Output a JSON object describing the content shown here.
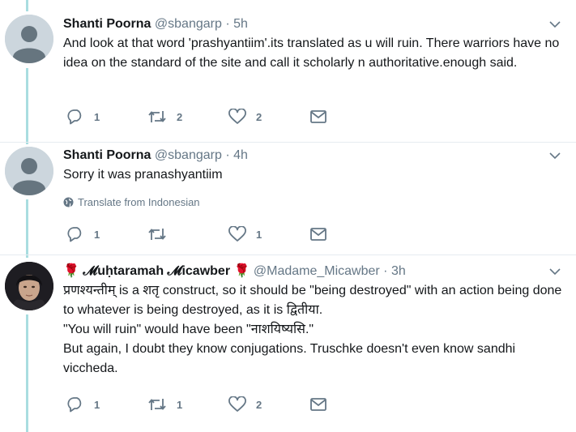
{
  "tweets": [
    {
      "name": "Shanti Poorna",
      "handle": "@sbangarp",
      "dot": " · ",
      "time": "5h",
      "text": "And look at that word 'prashyantiim'.its translated as u will ruin. There warriors have no idea on the standard of the site  and call it scholarly n authoritative.enough said.",
      "actions": {
        "reply": "1",
        "retweet": "2",
        "like": "2"
      }
    },
    {
      "name": "Shanti Poorna",
      "handle": "@sbangarp",
      "dot": " · ",
      "time": "4h",
      "text": "Sorry it was pranashyantiim",
      "translate": "Translate from Indonesian",
      "actions": {
        "reply": "1",
        "retweet": "",
        "like": "1"
      }
    },
    {
      "name": "𝓜uḥtaramah 𝓜icawber",
      "name_emoji": "🌹",
      "handle": "@Madame_Micawber",
      "dot": " · ",
      "time": "3h",
      "text_lines": [
        "प्रणश्यन्तीम् is a शतृ construct, so it should be \"being destroyed\" with an action being done to whatever is being destroyed, as it is द्वितीया.",
        "\"You will ruin\" would have been \"नाशयिष्यसि.\"",
        "But again, I doubt they know conjugations. Truschke doesn't even know sandhi viccheda."
      ],
      "actions": {
        "reply": "1",
        "retweet": "1",
        "like": "2"
      }
    }
  ],
  "colors": {
    "thread_line": "#a9dde0",
    "muted": "#657786",
    "text": "#14171a"
  },
  "icons": [
    "reply-icon",
    "retweet-icon",
    "like-icon",
    "message-icon",
    "chevron-down-icon",
    "globe-icon",
    "rose-icon"
  ]
}
